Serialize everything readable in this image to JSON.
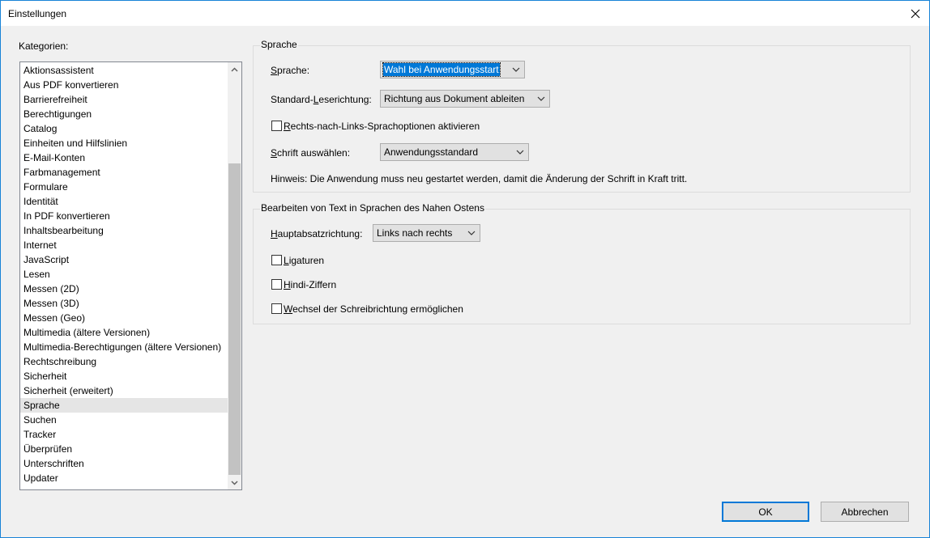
{
  "window": {
    "title": "Einstellungen"
  },
  "categories": {
    "label": "Kategorien:",
    "items": [
      "Aktionsassistent",
      "Aus PDF konvertieren",
      "Barrierefreiheit",
      "Berechtigungen",
      "Catalog",
      "Einheiten und Hilfslinien",
      "E-Mail-Konten",
      "Farbmanagement",
      "Formulare",
      "Identität",
      "In PDF konvertieren",
      "Inhaltsbearbeitung",
      "Internet",
      "JavaScript",
      "Lesen",
      "Messen (2D)",
      "Messen (3D)",
      "Messen (Geo)",
      "Multimedia (ältere Versionen)",
      "Multimedia-Berechtigungen (ältere Versionen)",
      "Rechtschreibung",
      "Sicherheit",
      "Sicherheit (erweitert)",
      "Sprache",
      "Suchen",
      "Tracker",
      "Überprüfen",
      "Unterschriften",
      "Updater"
    ],
    "selected": "Sprache"
  },
  "sprache_group": {
    "title": "Sprache",
    "sprache_label": "Sprache:",
    "sprache_value": "Wahl bei Anwendungsstart",
    "leserichtung_label": "Standard-Leserichtung:",
    "leserichtung_value": "Richtung aus Dokument ableiten",
    "rtl_checkbox_label": "Rechts-nach-Links-Sprachoptionen aktivieren",
    "rtl_checked": false,
    "schrift_label": "Schrift auswählen:",
    "schrift_value": "Anwendungsstandard",
    "hinweis": "Hinweis: Die Anwendung muss neu gestartet werden, damit die Änderung der Schrift in Kraft tritt."
  },
  "nahost_group": {
    "title": "Bearbeiten von Text in Sprachen des Nahen Ostens",
    "richtung_label": "Hauptabsatzrichtung:",
    "richtung_value": "Links nach rechts",
    "ligaturen_label": "Ligaturen",
    "ligaturen_checked": false,
    "hindi_label": "Hindi-Ziffern",
    "hindi_checked": false,
    "wechsel_label": "Wechsel der Schreibrichtung ermöglichen",
    "wechsel_checked": false
  },
  "buttons": {
    "ok": "OK",
    "cancel": "Abbrechen"
  },
  "colors": {
    "accent": "#0078d7",
    "window_border": "#1883d7",
    "dialog_bg": "#f0f0f0"
  },
  "icons": {
    "close": "close-icon",
    "scroll_up": "chevron-up-icon",
    "scroll_down": "chevron-down-icon",
    "dropdown": "chevron-down-icon"
  }
}
